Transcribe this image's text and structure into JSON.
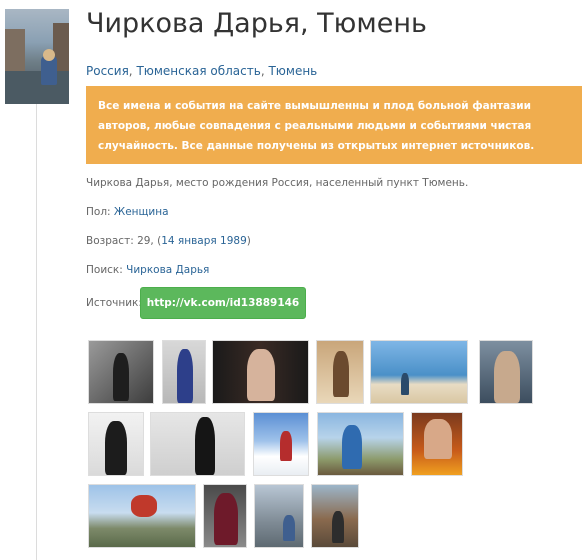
{
  "profile": {
    "name": "Чиркова Дарья, Тюмень",
    "location": {
      "country": "Россия",
      "sep1": ", ",
      "region": "Тюменская область",
      "sep2": ", ",
      "city": "Тюмень"
    },
    "notice": "Все имена и события на сайте вымышленны и плод больной фантазии авторов, любые совпадения с реальными людьми и событиями чистая случайность. Все данные получены из открытых интернет источников.",
    "birth_line": "Чиркова Дарья, место рождения Россия, населенный пункт Тюмень.",
    "gender_label": "Пол: ",
    "gender_value": "Женщина",
    "age_label": "Возраст: 29, (",
    "age_date": "14 января 1989",
    "age_close": ")",
    "search_label": "Поиск: ",
    "search_value": "Чиркова Дарья",
    "source_label": "Источник:",
    "source_button": "http://vk.com/id13889146"
  },
  "colors": {
    "notice_bg": "#f0ad4e",
    "button_bg": "#5cb85c",
    "link": "#2a6496"
  },
  "gallery_count": 15
}
